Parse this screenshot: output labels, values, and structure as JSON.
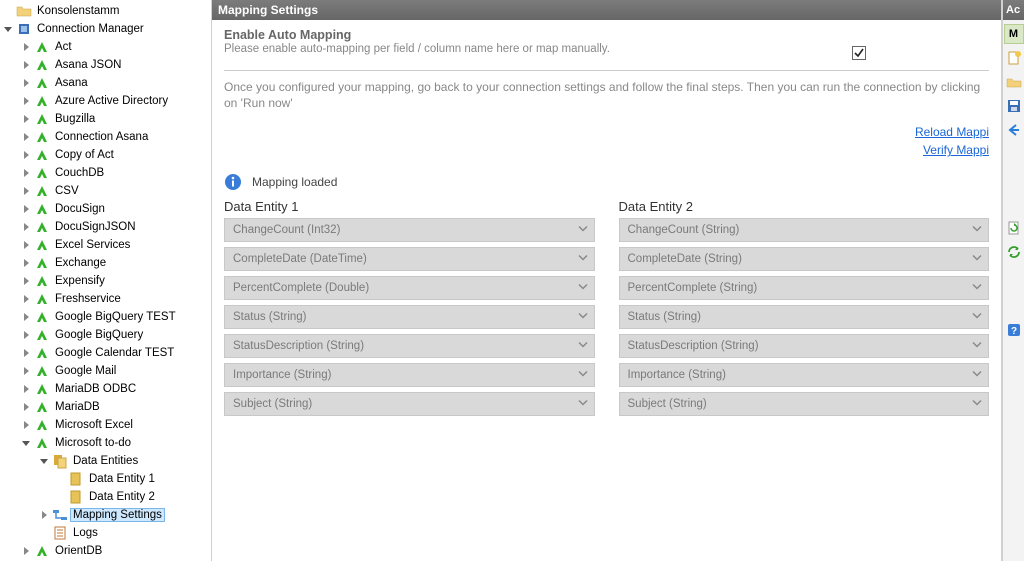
{
  "tree": {
    "root": "Konsolenstamm",
    "connection_manager": "Connection Manager",
    "items": [
      "Act",
      "Asana JSON",
      "Asana",
      "Azure Active Directory",
      "Bugzilla",
      "Connection Asana",
      "Copy of Act",
      "CouchDB",
      "CSV",
      "DocuSign",
      "DocuSignJSON",
      "Excel Services",
      "Exchange",
      "Expensify",
      "Freshservice",
      "Google BigQuery TEST",
      "Google BigQuery",
      "Google Calendar TEST",
      "Google Mail",
      "MariaDB ODBC",
      "MariaDB",
      "Microsoft Excel",
      "Microsoft to-do"
    ],
    "todo_children": {
      "data_entities": "Data Entities",
      "entity1": "Data Entity 1",
      "entity2": "Data Entity 2",
      "mapping": "Mapping Settings",
      "logs": "Logs"
    },
    "after_todo": [
      "OrientDB"
    ]
  },
  "panel": {
    "title": "Mapping Settings",
    "enable_heading": "Enable Auto Mapping",
    "enable_sub": "Please enable auto-mapping per field / column name here or map manually.",
    "checked": true,
    "hint": "Once you configured your mapping, go back to your connection settings and follow the final steps. Then you can run the connection by clicking on 'Run now'",
    "link_reload": "Reload Mappings",
    "link_reload_visible": "Reload Mappi",
    "link_verify": "Verify Mappings",
    "link_verify_visible": "Verify Mappi",
    "info": "Mapping loaded",
    "entity1_title": "Data Entity 1",
    "entity2_title": "Data Entity 2",
    "entity1_fields": [
      "ChangeCount (Int32)",
      "CompleteDate (DateTime)",
      "PercentComplete (Double)",
      "Status (String)",
      "StatusDescription (String)",
      "Importance (String)",
      "Subject (String)"
    ],
    "entity2_fields": [
      "ChangeCount (String)",
      "CompleteDate (String)",
      "PercentComplete (String)",
      "Status (String)",
      "StatusDescription (String)",
      "Importance (String)",
      "Subject (String)"
    ]
  },
  "right": {
    "header": "Ac",
    "tab": "M"
  }
}
